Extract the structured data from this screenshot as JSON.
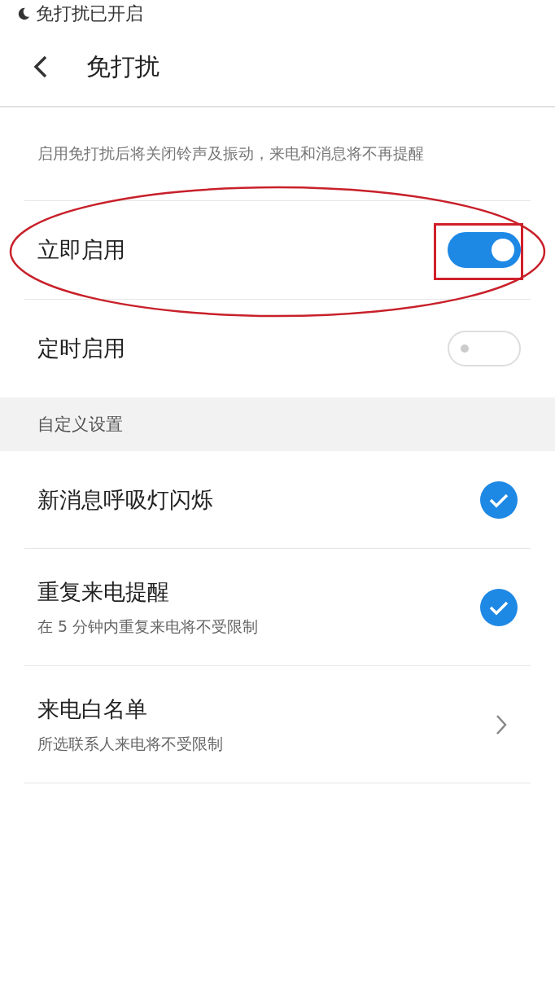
{
  "status_notice": "免打扰已开启",
  "header": {
    "title": "免打扰"
  },
  "description": "启用免打扰后将关闭铃声及振动，来电和消息将不再提醒",
  "toggles": [
    {
      "label": "立即启用",
      "on": true,
      "highlighted": true
    },
    {
      "label": "定时启用",
      "on": false,
      "highlighted": false
    }
  ],
  "section": "自定义设置",
  "items": [
    {
      "kind": "check",
      "title": "新消息呼吸灯闪烁",
      "checked": true
    },
    {
      "kind": "check",
      "title": "重复来电提醒",
      "subtitle": "在 5 分钟内重复来电将不受限制",
      "checked": true
    },
    {
      "kind": "link",
      "title": "来电白名单",
      "subtitle": "所选联系人来电将不受限制"
    }
  ]
}
